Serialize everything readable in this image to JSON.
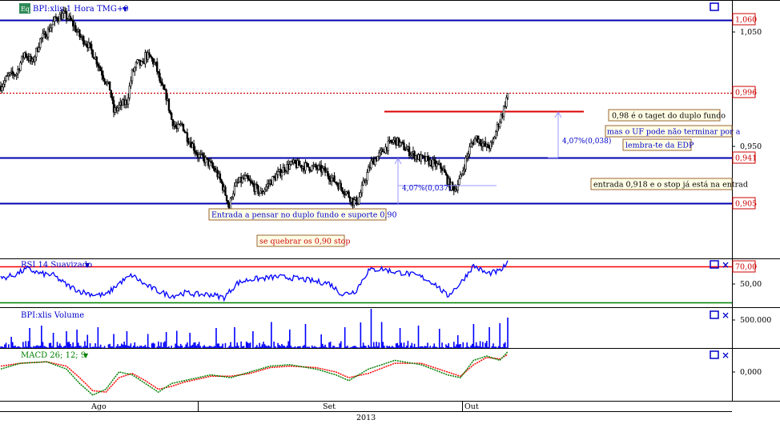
{
  "colors": {
    "background": "#ffffff",
    "level_line": "#0000b0",
    "dotted_line": "#cc0000",
    "target_line": "#dd0000",
    "candle_body": "#000000",
    "rsi_line": "#0000ff",
    "rsi_upper": "#ff0000",
    "rsi_lower": "#008000",
    "volume": "#0000ff",
    "macd_line": "#008000",
    "macd_signal": "#ff0000",
    "annotation_bg": "#ffffe6",
    "annotation_border": "#996633",
    "price_label_text": "#cc0000",
    "axis_text": "#000000",
    "measure_text": "#0000cc",
    "panel_title": "#0000cc"
  },
  "panels": {
    "price_title": "BPI:xlis 1 Hora TMG+0",
    "eq_badge": "Eq",
    "rsi_title": "RSI 14 Suavizado",
    "volume_title": "BPI:xlis Volume",
    "macd_title": "MACD 26; 12; 9"
  },
  "price_axis": {
    "tick_labels": [
      "1,050",
      "0,950"
    ],
    "highlight_labels": [
      "1,060",
      "0,996",
      "0,941",
      "0,905"
    ]
  },
  "rsi_axis": {
    "tick_labels": [
      "50,00"
    ],
    "highlight_label": "70,00"
  },
  "volume_axis": {
    "tick_labels": [
      "500.000"
    ]
  },
  "macd_axis": {
    "tick_labels": [
      "0,000"
    ]
  },
  "time_axis": {
    "month_labels": [
      "Ago",
      "Set",
      "Out"
    ],
    "year_label": "2013"
  },
  "annotations": {
    "target": "0,98 é o taget do duplo fundo",
    "uf_warning": "mas o UF pode não terminar por a",
    "edp_reminder": "lembra-te da EDP",
    "entry": "entrada 0,918 e o stop já está na entrad",
    "double_bottom": "Entrada a pensar no duplo fundo e suporte 0,90",
    "stop": "se quebrar os 0,90 stop",
    "measure_upper": "4,07%(0,038)",
    "measure_lower": "4,07%(0,037)"
  },
  "chart_data": [
    {
      "type": "candlestick",
      "title": "BPI:xlis 1 Hora TMG+0",
      "ylim": [
        0.868,
        1.068
      ],
      "y_ticks": [
        1.05,
        0.95
      ],
      "horizontal_levels": [
        1.06,
        0.941,
        0.905
      ],
      "dotted_level": 0.996,
      "target_level": 0.98,
      "x_labels": [
        "Ago",
        "Set",
        "Out"
      ],
      "close_path": [
        [
          0,
          1.002
        ],
        [
          6,
          1.01
        ],
        [
          12,
          1.012
        ],
        [
          18,
          1.028
        ],
        [
          24,
          1.02
        ],
        [
          30,
          1.038
        ],
        [
          36,
          1.045
        ],
        [
          42,
          1.055
        ],
        [
          48,
          1.058
        ],
        [
          54,
          1.052
        ],
        [
          60,
          1.041
        ],
        [
          66,
          1.035
        ],
        [
          72,
          1.024
        ],
        [
          78,
          1.01
        ],
        [
          83,
          1.0
        ],
        [
          86,
          0.982
        ],
        [
          90,
          0.986
        ],
        [
          96,
          0.99
        ],
        [
          100,
          1.012
        ],
        [
          104,
          1.02
        ],
        [
          108,
          1.018
        ],
        [
          110,
          1.026
        ],
        [
          114,
          1.024
        ],
        [
          118,
          1.018
        ],
        [
          122,
          1.002
        ],
        [
          126,
          0.994
        ],
        [
          130,
          0.976
        ],
        [
          134,
          0.968
        ],
        [
          138,
          0.972
        ],
        [
          142,
          0.962
        ],
        [
          146,
          0.956
        ],
        [
          150,
          0.948
        ],
        [
          156,
          0.944
        ],
        [
          160,
          0.94
        ],
        [
          164,
          0.935
        ],
        [
          168,
          0.926
        ],
        [
          172,
          0.915
        ],
        [
          174,
          0.906
        ],
        [
          176,
          0.918
        ],
        [
          180,
          0.926
        ],
        [
          186,
          0.93
        ],
        [
          192,
          0.924
        ],
        [
          198,
          0.918
        ],
        [
          204,
          0.926
        ],
        [
          210,
          0.932
        ],
        [
          216,
          0.938
        ],
        [
          222,
          0.941
        ],
        [
          228,
          0.94
        ],
        [
          234,
          0.939
        ],
        [
          240,
          0.938
        ],
        [
          246,
          0.936
        ],
        [
          252,
          0.93
        ],
        [
          258,
          0.924
        ],
        [
          264,
          0.918
        ],
        [
          268,
          0.912
        ],
        [
          272,
          0.912
        ],
        [
          276,
          0.925
        ],
        [
          282,
          0.942
        ],
        [
          288,
          0.948
        ],
        [
          294,
          0.955
        ],
        [
          300,
          0.96
        ],
        [
          306,
          0.955
        ],
        [
          312,
          0.95
        ],
        [
          318,
          0.946
        ],
        [
          324,
          0.944
        ],
        [
          330,
          0.941
        ],
        [
          336,
          0.938
        ],
        [
          342,
          0.924
        ],
        [
          346,
          0.922
        ],
        [
          350,
          0.93
        ],
        [
          354,
          0.944
        ],
        [
          358,
          0.956
        ],
        [
          362,
          0.962
        ],
        [
          366,
          0.958
        ],
        [
          370,
          0.954
        ],
        [
          374,
          0.956
        ],
        [
          378,
          0.97
        ],
        [
          382,
          0.981
        ],
        [
          386,
          0.996
        ]
      ]
    },
    {
      "type": "line",
      "title": "RSI 14 Suavizado",
      "ylim": [
        20,
        80
      ],
      "y_ticks": [
        50
      ],
      "levels": [
        70,
        30
      ],
      "path": [
        [
          0,
          56
        ],
        [
          10,
          60
        ],
        [
          20,
          68
        ],
        [
          30,
          62
        ],
        [
          40,
          60
        ],
        [
          50,
          48
        ],
        [
          60,
          40
        ],
        [
          70,
          36
        ],
        [
          80,
          35
        ],
        [
          90,
          50
        ],
        [
          100,
          60
        ],
        [
          110,
          48
        ],
        [
          120,
          40
        ],
        [
          130,
          34
        ],
        [
          140,
          38
        ],
        [
          150,
          36
        ],
        [
          160,
          36
        ],
        [
          170,
          32
        ],
        [
          180,
          50
        ],
        [
          190,
          55
        ],
        [
          200,
          56
        ],
        [
          210,
          58
        ],
        [
          220,
          57
        ],
        [
          230,
          55
        ],
        [
          240,
          52
        ],
        [
          250,
          50
        ],
        [
          260,
          36
        ],
        [
          270,
          40
        ],
        [
          280,
          66
        ],
        [
          290,
          68
        ],
        [
          300,
          64
        ],
        [
          310,
          62
        ],
        [
          320,
          58
        ],
        [
          330,
          50
        ],
        [
          340,
          34
        ],
        [
          350,
          50
        ],
        [
          360,
          72
        ],
        [
          370,
          62
        ],
        [
          380,
          65
        ],
        [
          386,
          75
        ]
      ]
    },
    {
      "type": "bar",
      "title": "BPI:xlis Volume",
      "ylim": [
        0,
        1000000
      ],
      "y_ticks": [
        500000
      ],
      "spikes": [
        [
          8,
          280000
        ],
        [
          22,
          500000
        ],
        [
          31,
          560000
        ],
        [
          40,
          380000
        ],
        [
          50,
          420000
        ],
        [
          58,
          460000
        ],
        [
          66,
          330000
        ],
        [
          74,
          520000
        ],
        [
          86,
          350000
        ],
        [
          96,
          420000
        ],
        [
          112,
          350000
        ],
        [
          126,
          400000
        ],
        [
          134,
          430000
        ],
        [
          144,
          380000
        ],
        [
          164,
          500000
        ],
        [
          178,
          520000
        ],
        [
          192,
          420000
        ],
        [
          206,
          650000
        ],
        [
          220,
          460000
        ],
        [
          232,
          600000
        ],
        [
          244,
          340000
        ],
        [
          262,
          520000
        ],
        [
          274,
          640000
        ],
        [
          282,
          980000
        ],
        [
          290,
          650000
        ],
        [
          304,
          500000
        ],
        [
          318,
          560000
        ],
        [
          334,
          480000
        ],
        [
          348,
          320000
        ],
        [
          360,
          600000
        ],
        [
          372,
          520000
        ],
        [
          380,
          620000
        ],
        [
          386,
          760000
        ]
      ]
    },
    {
      "type": "line",
      "title": "MACD 26; 12; 9",
      "ylim": [
        -0.024,
        0.012
      ],
      "y_ticks": [
        0.0
      ],
      "series": [
        {
          "path": [
            [
              0,
              -0.002
            ],
            [
              15,
              0.002
            ],
            [
              35,
              0.003
            ],
            [
              50,
              -0.002
            ],
            [
              60,
              -0.012
            ],
            [
              70,
              -0.02
            ],
            [
              80,
              -0.016
            ],
            [
              90,
              -0.004
            ],
            [
              100,
              -0.006
            ],
            [
              110,
              -0.012
            ],
            [
              120,
              -0.018
            ],
            [
              130,
              -0.012
            ],
            [
              140,
              -0.01
            ],
            [
              160,
              -0.006
            ],
            [
              175,
              -0.008
            ],
            [
              190,
              -0.004
            ],
            [
              205,
              0.0
            ],
            [
              220,
              0.001
            ],
            [
              240,
              -0.002
            ],
            [
              255,
              -0.006
            ],
            [
              265,
              -0.01
            ],
            [
              280,
              -0.002
            ],
            [
              300,
              0.004
            ],
            [
              320,
              0.001
            ],
            [
              340,
              -0.006
            ],
            [
              350,
              -0.008
            ],
            [
              360,
              0.004
            ],
            [
              370,
              0.007
            ],
            [
              380,
              0.004
            ],
            [
              386,
              0.01
            ]
          ]
        },
        {
          "path": [
            [
              0,
              0.0
            ],
            [
              15,
              0.002
            ],
            [
              35,
              0.003
            ],
            [
              50,
              0.0
            ],
            [
              60,
              -0.008
            ],
            [
              70,
              -0.017
            ],
            [
              80,
              -0.018
            ],
            [
              90,
              -0.008
            ],
            [
              100,
              -0.005
            ],
            [
              110,
              -0.01
            ],
            [
              120,
              -0.016
            ],
            [
              130,
              -0.014
            ],
            [
              140,
              -0.011
            ],
            [
              160,
              -0.007
            ],
            [
              175,
              -0.007
            ],
            [
              190,
              -0.005
            ],
            [
              205,
              -0.001
            ],
            [
              220,
              0.0
            ],
            [
              240,
              -0.001
            ],
            [
              255,
              -0.004
            ],
            [
              265,
              -0.008
            ],
            [
              280,
              -0.005
            ],
            [
              300,
              0.002
            ],
            [
              320,
              0.002
            ],
            [
              340,
              -0.004
            ],
            [
              350,
              -0.007
            ],
            [
              360,
              0.001
            ],
            [
              370,
              0.006
            ],
            [
              380,
              0.005
            ],
            [
              386,
              0.008
            ]
          ]
        }
      ]
    }
  ]
}
